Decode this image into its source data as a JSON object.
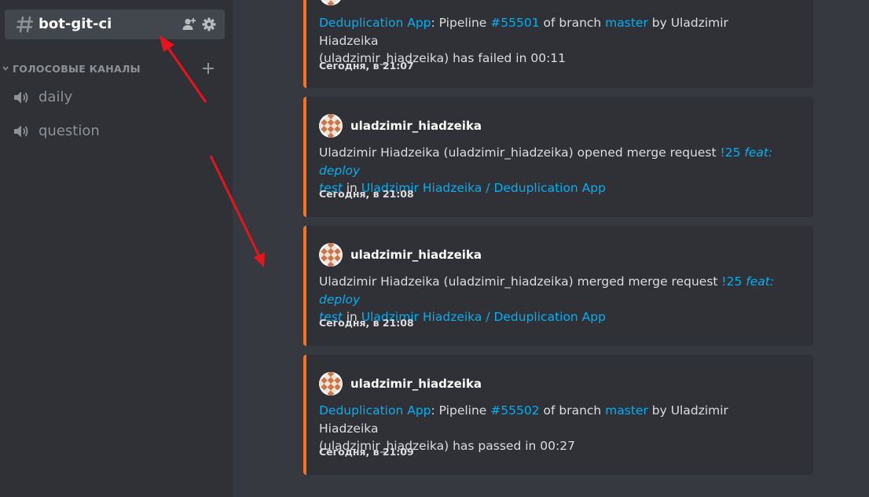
{
  "sidebar": {
    "active_channel": "bot-git-ci",
    "voice_category": "ГОЛОСОВЫЕ КАНАЛЫ",
    "voice_channels": [
      {
        "name": "daily"
      },
      {
        "name": "question"
      }
    ]
  },
  "messages": [
    {
      "author": "",
      "lines": [
        [
          {
            "t": "link",
            "v": "Deduplication App"
          },
          {
            "t": "text",
            "v": ": Pipeline "
          },
          {
            "t": "link",
            "v": "#55501"
          },
          {
            "t": "text",
            "v": " of branch "
          },
          {
            "t": "link",
            "v": "master"
          },
          {
            "t": "text",
            "v": " by Uladzimir Hiadzeika"
          }
        ],
        [
          {
            "t": "text",
            "v": "(uladzimir_hiadzeika) has failed in 00:11"
          }
        ]
      ],
      "timestamp": "Сегодня, в 21:07"
    },
    {
      "author": "uladzimir_hiadzeika",
      "lines": [
        [
          {
            "t": "text",
            "v": "Uladzimir Hiadzeika (uladzimir_hiadzeika) opened merge request "
          },
          {
            "t": "link",
            "v": "!25 "
          },
          {
            "t": "linki",
            "v": "feat: deploy"
          }
        ],
        [
          {
            "t": "linki",
            "v": "test"
          },
          {
            "t": "text",
            "v": " in "
          },
          {
            "t": "link",
            "v": "Uladzimir Hiadzeika / Deduplication App"
          }
        ]
      ],
      "timestamp": "Сегодня, в 21:08"
    },
    {
      "author": "uladzimir_hiadzeika",
      "lines": [
        [
          {
            "t": "text",
            "v": "Uladzimir Hiadzeika (uladzimir_hiadzeika) merged merge request "
          },
          {
            "t": "link",
            "v": "!25 "
          },
          {
            "t": "linki",
            "v": "feat: deploy"
          }
        ],
        [
          {
            "t": "linki",
            "v": "test"
          },
          {
            "t": "text",
            "v": " in "
          },
          {
            "t": "link",
            "v": "Uladzimir Hiadzeika / Deduplication App"
          }
        ]
      ],
      "timestamp": "Сегодня, в 21:08"
    },
    {
      "author": "uladzimir_hiadzeika",
      "lines": [
        [
          {
            "t": "link",
            "v": "Deduplication App"
          },
          {
            "t": "text",
            "v": ": Pipeline "
          },
          {
            "t": "link",
            "v": "#55502"
          },
          {
            "t": "text",
            "v": " of branch "
          },
          {
            "t": "link",
            "v": "master"
          },
          {
            "t": "text",
            "v": " by Uladzimir Hiadzeika"
          }
        ],
        [
          {
            "t": "text",
            "v": "(uladzimir_hiadzeika) has passed in 00:27"
          }
        ]
      ],
      "timestamp": "Сегодня, в 21:09"
    }
  ],
  "colors": {
    "embed_border": "#f47421",
    "link": "#00b0f4",
    "annotation_arrow": "#e8141c"
  }
}
